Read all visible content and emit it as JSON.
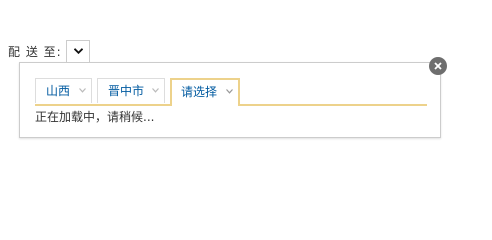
{
  "delivery": {
    "label": "配 送 至:",
    "trigger_icon": "chevron-down-icon"
  },
  "area_selector": {
    "tabs": [
      {
        "label": "山西",
        "selected": false
      },
      {
        "label": "晋中市",
        "selected": false
      },
      {
        "label": "请选择",
        "selected": true
      }
    ],
    "loading_text": "正在加载中，请稍候...",
    "close_icon": "close-icon"
  },
  "colors": {
    "tab_text": "#005aa0",
    "active_border": "#edd28b",
    "close_bg": "#6e6e6e"
  }
}
